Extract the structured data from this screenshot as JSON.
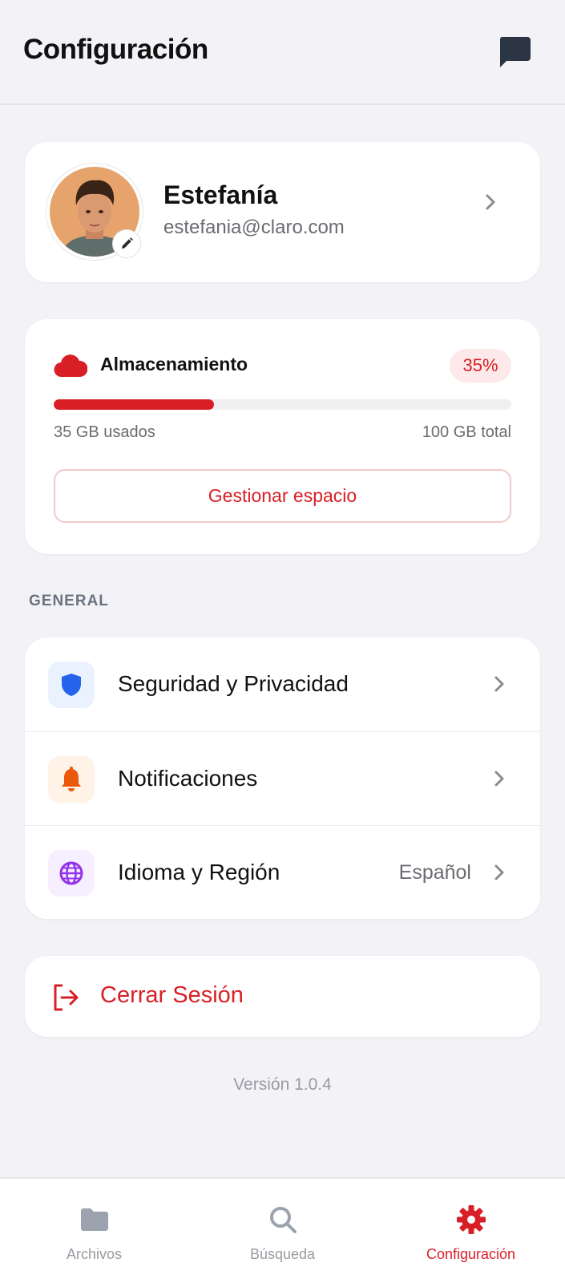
{
  "header": {
    "title": "Configuración",
    "chat_icon": "chat-bubble-icon"
  },
  "profile": {
    "name": "Estefanía",
    "email": "estefania@claro.com",
    "edit_icon": "pencil-icon"
  },
  "storage": {
    "title": "Almacenamiento",
    "percent_label": "35%",
    "percent": 0.35,
    "used": "35 GB usados",
    "total": "100 GB total",
    "manage_label": "Gestionar espacio",
    "accent": "#d81f26"
  },
  "general": {
    "section_label": "GENERAL",
    "items": [
      {
        "label": "Seguridad y Privacidad",
        "icon": "shield-icon",
        "value": ""
      },
      {
        "label": "Notificaciones",
        "icon": "bell-icon",
        "value": ""
      },
      {
        "label": "Idioma y Región",
        "icon": "globe-icon",
        "value": "Español"
      }
    ]
  },
  "logout": {
    "label": "Cerrar Sesión",
    "icon": "logout-icon"
  },
  "version": "Versión 1.0.4",
  "tabbar": {
    "tabs": [
      {
        "label": "Archivos",
        "icon": "folder-icon",
        "active": false
      },
      {
        "label": "Búsqueda",
        "icon": "search-icon",
        "active": false
      },
      {
        "label": "Configuración",
        "icon": "gear-icon",
        "active": true
      }
    ]
  }
}
